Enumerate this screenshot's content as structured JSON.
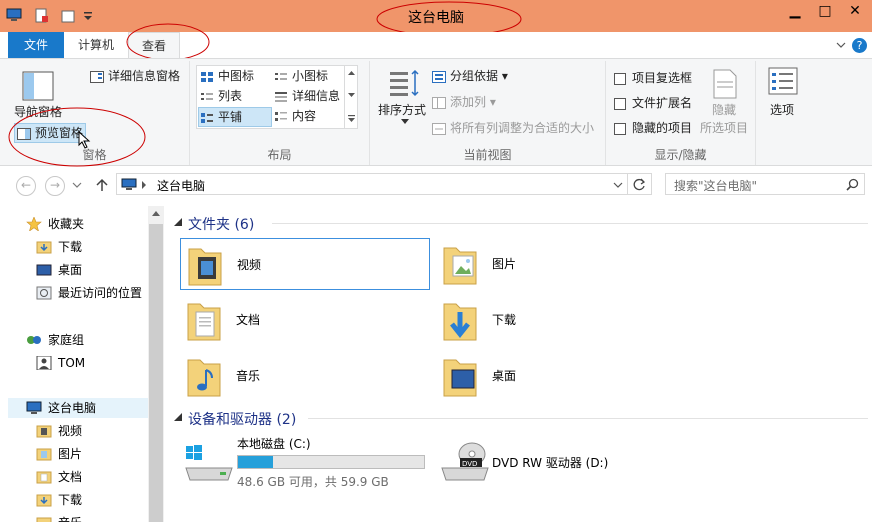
{
  "window": {
    "title": "这台电脑",
    "minimize": "▁",
    "maximize": "□",
    "close": "✕",
    "help": "?"
  },
  "ribbon_tabs": {
    "file": "文件",
    "computer": "计算机",
    "view": "查看"
  },
  "ribbon": {
    "pane_group": {
      "nav_pane": "导航窗格",
      "preview_pane": "预览窗格",
      "details_pane": "详细信息窗格",
      "label": "窗格"
    },
    "layout_group": {
      "medium_icons": "中图标",
      "small_icons": "小图标",
      "list": "列表",
      "details": "详细信息",
      "tiles": "平铺",
      "content": "内容",
      "label": "布局"
    },
    "current_view_group": {
      "sort_by": "排序方式",
      "group_by": "分组依据",
      "add_columns": "添加列",
      "size_all_columns": "将所有列调整为合适的大小",
      "label": "当前视图"
    },
    "show_hide_group": {
      "item_checkboxes": "项目复选框",
      "file_extensions": "文件扩展名",
      "hidden_items": "隐藏的项目",
      "hide": "隐藏",
      "selected_items": "所选项目",
      "label": "显示/隐藏"
    },
    "options": "选项"
  },
  "address": {
    "path": "这台电脑",
    "search_placeholder": "搜索\"这台电脑\""
  },
  "nav_pane": {
    "favorites": "收藏夹",
    "downloads": "下载",
    "desktop": "桌面",
    "recent": "最近访问的位置",
    "homegroup": "家庭组",
    "user": "TOM",
    "this_pc": "这台电脑",
    "pc_videos": "视频",
    "pc_pictures": "图片",
    "pc_documents": "文档",
    "pc_downloads": "下载",
    "pc_music": "音乐"
  },
  "content": {
    "folders_header": "文件夹 (6)",
    "folders": [
      {
        "name": "视频",
        "icon": "video-folder-icon"
      },
      {
        "name": "图片",
        "icon": "pictures-folder-icon"
      },
      {
        "name": "文档",
        "icon": "documents-folder-icon"
      },
      {
        "name": "下载",
        "icon": "downloads-folder-icon"
      },
      {
        "name": "音乐",
        "icon": "music-folder-icon"
      },
      {
        "name": "桌面",
        "icon": "desktop-folder-icon"
      }
    ],
    "devices_header": "设备和驱动器 (2)",
    "drive_c": {
      "name": "本地磁盘 (C:)",
      "space": "48.6 GB 可用，共 59.9 GB",
      "used_fraction": 0.19
    },
    "drive_d": {
      "name": "DVD RW 驱动器 (D:)"
    }
  },
  "colors": {
    "titlebar": "#f0956a",
    "file_tab": "#1979ca",
    "section_header": "#1e3287",
    "selection": "#3c8fde",
    "drive_bar": "#26a0da",
    "annotation": "#cc0000"
  }
}
